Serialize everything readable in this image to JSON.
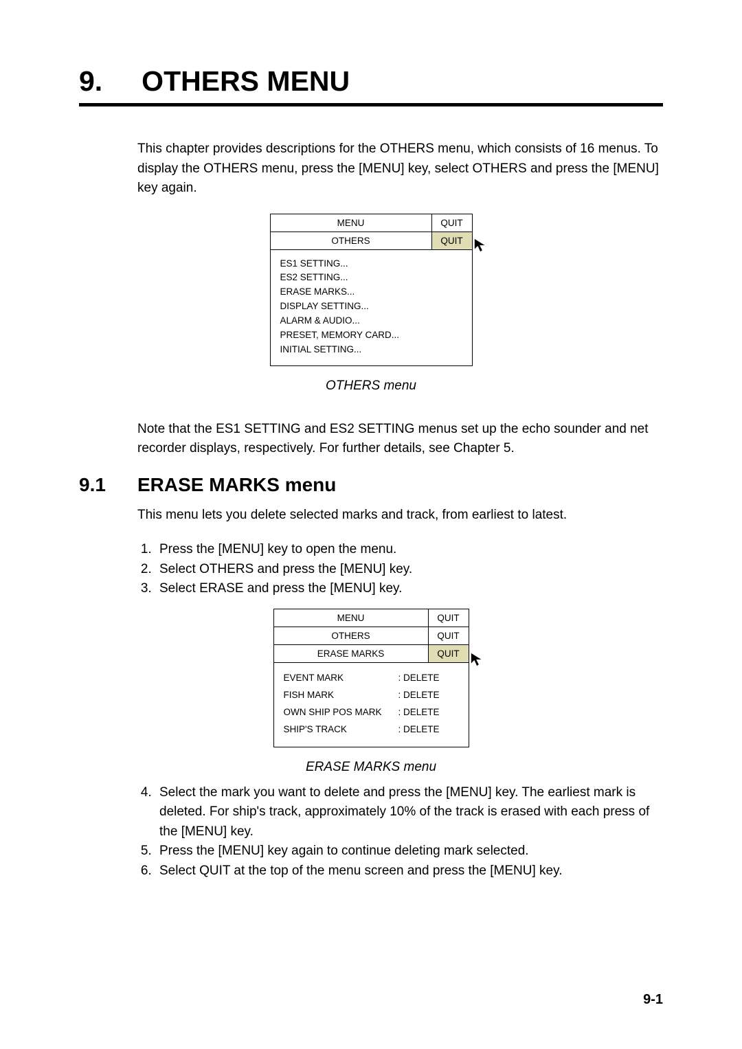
{
  "chapter": {
    "number": "9.",
    "title": "OTHERS MENU"
  },
  "intro_paragraph": "This chapter provides descriptions for the OTHERS menu, which consists of 16 menus. To display the OTHERS menu, press the [MENU] key, select OTHERS and press the [MENU] key again.",
  "menu1": {
    "header1_left": "MENU",
    "header1_right": "QUIT",
    "header2_left": "OTHERS",
    "header2_right": "QUIT",
    "items": [
      "ES1 SETTING...",
      "ES2 SETTING...",
      "ERASE MARKS...",
      "DISPLAY SETTING...",
      "ALARM & AUDIO...",
      "PRESET, MEMORY CARD...",
      "INITIAL SETTING..."
    ]
  },
  "caption1": "OTHERS menu",
  "note_paragraph": "Note that the ES1 SETTING and ES2 SETTING menus set up the echo sounder and net recorder displays, respectively. For further details, see Chapter 5.",
  "section": {
    "number": "9.1",
    "title": "ERASE MARKS menu"
  },
  "section_intro": "This menu lets you delete selected marks and track, from earliest to latest.",
  "steps123": [
    "Press the [MENU] key to open the menu.",
    "Select OTHERS and press the [MENU] key.",
    "Select ERASE and press the [MENU] key."
  ],
  "menu2": {
    "header1_left": "MENU",
    "header1_right": "QUIT",
    "header2_left": "OTHERS",
    "header2_right": "QUIT",
    "header3_left": "ERASE MARKS",
    "header3_right": "QUIT",
    "rows": [
      {
        "label": "EVENT MARK",
        "value": ": DELETE"
      },
      {
        "label": "FISH MARK",
        "value": ": DELETE"
      },
      {
        "label": "OWN SHIP POS MARK",
        "value": ": DELETE"
      },
      {
        "label": "SHIP'S TRACK",
        "value": ": DELETE"
      }
    ]
  },
  "caption2": "ERASE MARKS menu",
  "steps456": [
    "Select the mark you want to delete and press the [MENU] key. The earliest mark is deleted. For ship's track, approximately 10% of the track is erased with each press of the [MENU] key.",
    "Press the [MENU] key again to continue deleting mark selected.",
    "Select QUIT at the top of the menu screen and press the [MENU] key."
  ],
  "page_number": "9-1"
}
